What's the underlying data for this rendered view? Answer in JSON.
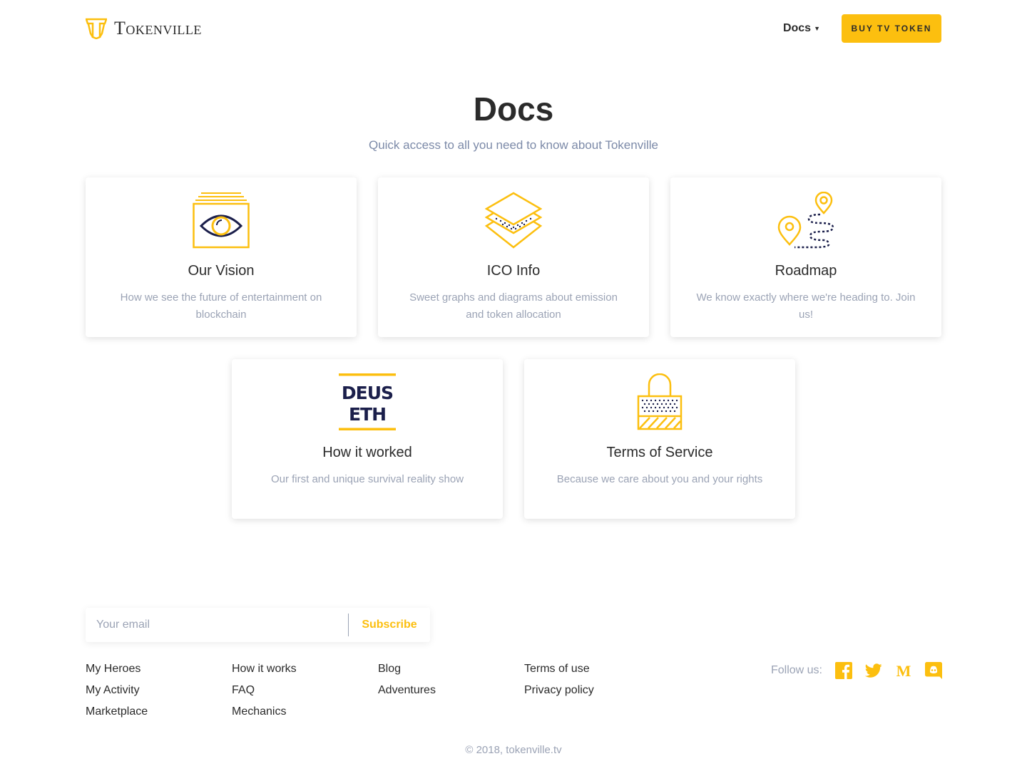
{
  "header": {
    "brand": "Tokenville",
    "nav_docs": "Docs",
    "buy_button": "BUY TV TOKEN"
  },
  "page": {
    "title": "Docs",
    "subtitle": "Quick access to all you need to know about Tokenville"
  },
  "cards": [
    {
      "title": "Our Vision",
      "desc": "How we see the future of entertainment on blockchain",
      "icon": "eye-icon"
    },
    {
      "title": "ICO Info",
      "desc": "Sweet graphs and diagrams about emission and token allocation",
      "icon": "layers-icon"
    },
    {
      "title": "Roadmap",
      "desc": "We know exactly where we're heading to. Join us!",
      "icon": "map-pins-icon"
    },
    {
      "title": "How it worked",
      "desc": "Our first and unique survival reality show",
      "icon": "deus-eth-logo"
    },
    {
      "title": "Terms of Service",
      "desc": "Because we care about you and your rights",
      "icon": "lock-icon"
    }
  ],
  "deus_logo": {
    "line1": "DEUS",
    "line2": "ETH"
  },
  "footer": {
    "email_placeholder": "Your email",
    "subscribe": "Subscribe",
    "col1": [
      "My Heroes",
      "My Activity",
      "Marketplace"
    ],
    "col2": [
      "How it works",
      "FAQ",
      "Mechanics"
    ],
    "col3": [
      "Blog",
      "Adventures"
    ],
    "col4": [
      "Terms of use",
      "Privacy policy"
    ],
    "follow_label": "Follow us:",
    "copyright": "© 2018, tokenville.tv"
  },
  "colors": {
    "accent": "#fcbf0f",
    "navy": "#1b1f4b",
    "muted": "#9ba3b5",
    "text": "#2b2b2b"
  }
}
